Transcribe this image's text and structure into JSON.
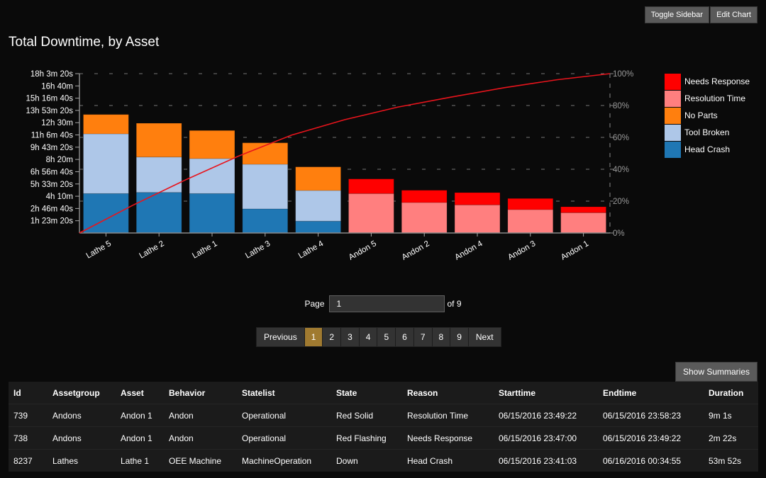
{
  "toolbar": {
    "toggle_sidebar_label": "Toggle Sidebar",
    "edit_chart_label": "Edit Chart"
  },
  "page_title": "Total Downtime, by Asset",
  "chart_data": {
    "type": "bar",
    "stacked": true,
    "title": "Total Downtime, by Asset",
    "xlabel": "",
    "ylabel": "",
    "categories": [
      "Lathe 5",
      "Lathe 2",
      "Lathe 1",
      "Lathe 3",
      "Lathe 4",
      "Andon 5",
      "Andon 2",
      "Andon 4",
      "Andon 3",
      "Andon 1"
    ],
    "series": [
      {
        "name": "Head Crash",
        "color": "#1f77b4",
        "values": [
          16090,
          16550,
          16090,
          9820,
          4820,
          0,
          0,
          0,
          0,
          0
        ]
      },
      {
        "name": "Tool Broken",
        "color": "#aec7e8",
        "values": [
          24350,
          14440,
          14250,
          18200,
          12510,
          0,
          0,
          0,
          0,
          0
        ]
      },
      {
        "name": "No Parts",
        "color": "#ff7f0e",
        "values": [
          7890,
          13780,
          11460,
          8760,
          9630,
          0,
          0,
          0,
          0,
          0
        ]
      },
      {
        "name": "Resolution Time",
        "color": "#ff7f7f",
        "values": [
          0,
          0,
          0,
          0,
          0,
          16090,
          12420,
          11470,
          9530,
          8290
        ]
      },
      {
        "name": "Needs Response",
        "color": "#ff0000",
        "values": [
          0,
          0,
          0,
          0,
          0,
          5950,
          5000,
          5000,
          4540,
          2400
        ]
      }
    ],
    "legend": [
      "Needs Response",
      "Resolution Time",
      "No Parts",
      "Tool Broken",
      "Head Crash"
    ],
    "legend_position": "right",
    "y_unit": "seconds",
    "ylim": [
      0,
      65000
    ],
    "y_ticks": [
      {
        "value": 5000,
        "label": "1h 23m 20s"
      },
      {
        "value": 10000,
        "label": "2h 46m 40s"
      },
      {
        "value": 15000,
        "label": "4h 10m"
      },
      {
        "value": 20000,
        "label": "5h 33m 20s"
      },
      {
        "value": 25000,
        "label": "6h 56m 40s"
      },
      {
        "value": 30000,
        "label": "8h 20m"
      },
      {
        "value": 35000,
        "label": "9h 43m 20s"
      },
      {
        "value": 40000,
        "label": "11h 6m 40s"
      },
      {
        "value": 45000,
        "label": "12h 30m"
      },
      {
        "value": 50000,
        "label": "13h 53m 20s"
      },
      {
        "value": 55000,
        "label": "15h 16m 40s"
      },
      {
        "value": 60000,
        "label": "16h 40m"
      },
      {
        "value": 65000,
        "label": "18h 3m 20s"
      }
    ],
    "cumulative_line": {
      "name": "Cumulative %",
      "color": "#e8141c",
      "y2lim": [
        0,
        100
      ]
    },
    "y2_ticks": [
      {
        "value": 0,
        "label": "0%"
      },
      {
        "value": 20,
        "label": "20%"
      },
      {
        "value": 40,
        "label": "40%"
      },
      {
        "value": 60,
        "label": "60%"
      },
      {
        "value": 80,
        "label": "80%"
      },
      {
        "value": 100,
        "label": "100%"
      }
    ],
    "grid": "dashed horizontal at y2 ticks"
  },
  "paging": {
    "page_label": "Page",
    "page_value": "1",
    "of_label": "of 9",
    "previous_label": "Previous",
    "next_label": "Next",
    "pages": [
      "1",
      "2",
      "3",
      "4",
      "5",
      "6",
      "7",
      "8",
      "9"
    ],
    "current_page": "1",
    "active_color": "#a07a30"
  },
  "show_summaries_label": "Show Summaries",
  "table": {
    "columns": [
      "Id",
      "Assetgroup",
      "Asset",
      "Behavior",
      "Statelist",
      "State",
      "Reason",
      "Starttime",
      "Endtime",
      "Duration"
    ],
    "rows": [
      [
        "739",
        "Andons",
        "Andon 1",
        "Andon",
        "Operational",
        "Red Solid",
        "Resolution Time",
        "06/15/2016 23:49:22",
        "06/15/2016 23:58:23",
        "9m 1s"
      ],
      [
        "738",
        "Andons",
        "Andon 1",
        "Andon",
        "Operational",
        "Red Flashing",
        "Needs Response",
        "06/15/2016 23:47:00",
        "06/15/2016 23:49:22",
        "2m 22s"
      ],
      [
        "8237",
        "Lathes",
        "Lathe 1",
        "OEE Machine",
        "MachineOperation",
        "Down",
        "Head Crash",
        "06/15/2016 23:41:03",
        "06/16/2016 00:34:55",
        "53m 52s"
      ]
    ]
  }
}
